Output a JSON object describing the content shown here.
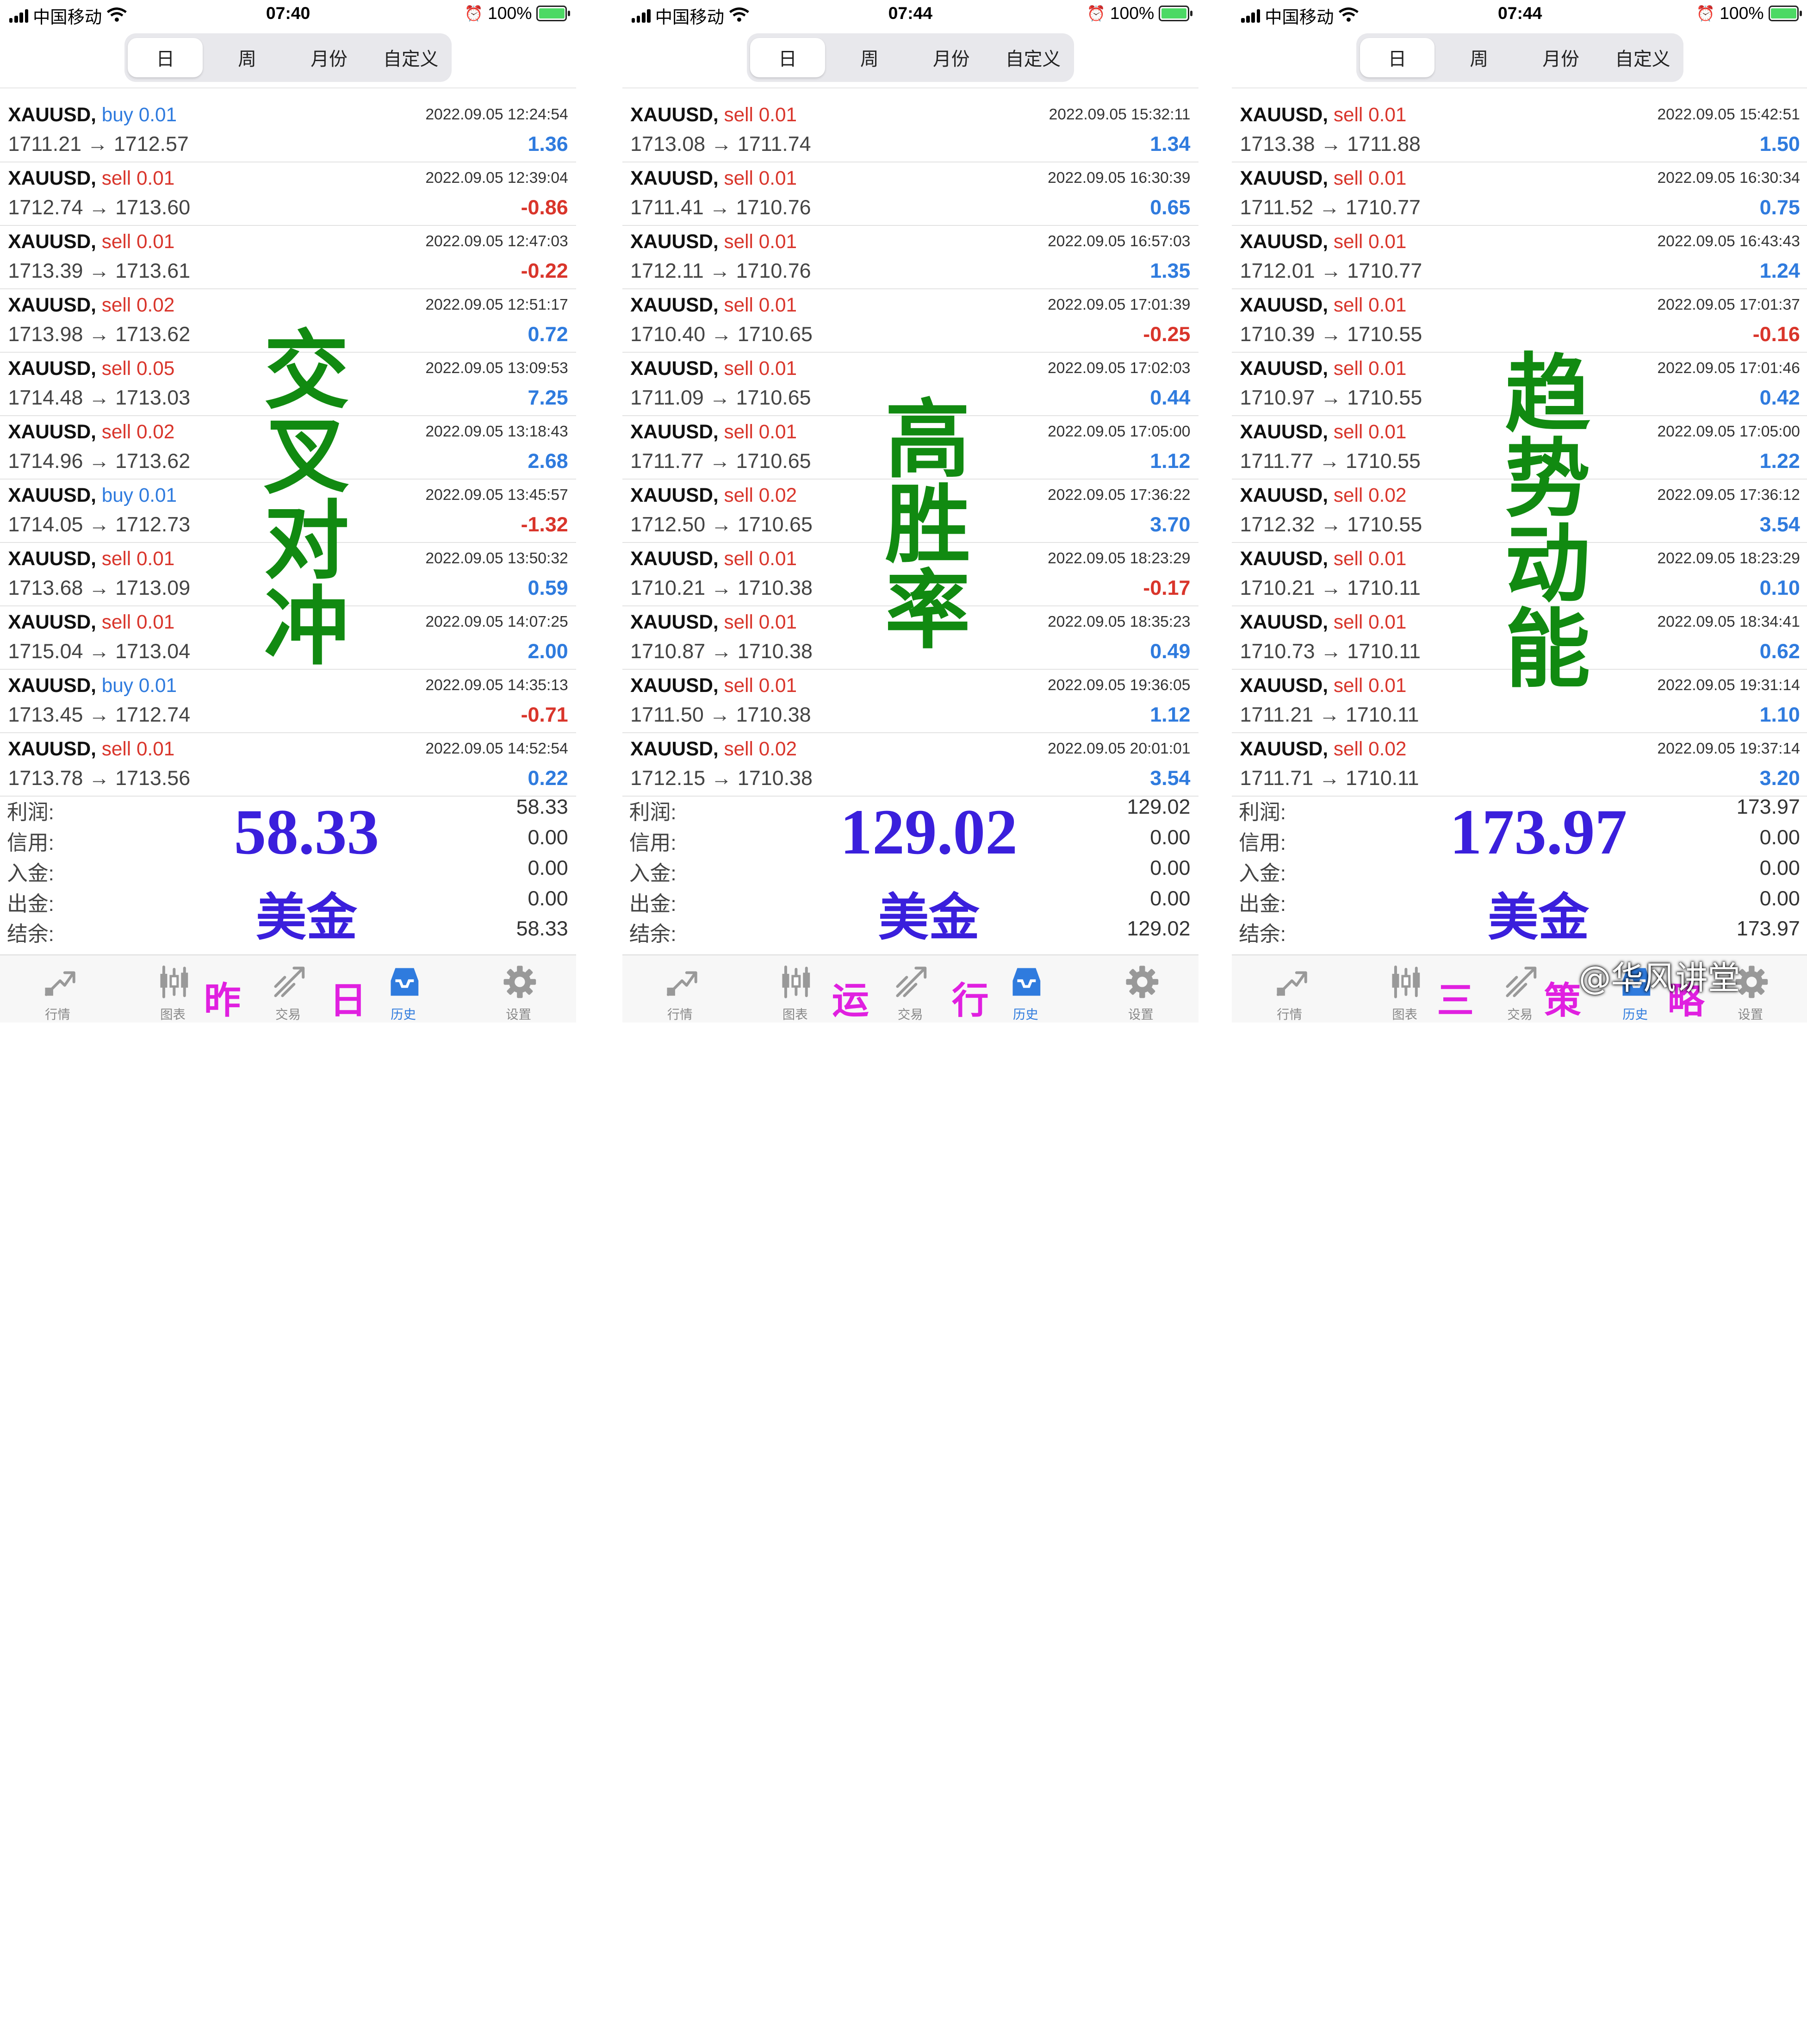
{
  "colors": {
    "accent_blue": "#2f7bde",
    "loss_red": "#d9352b",
    "overlay_green": "#118a11",
    "overlay_violet": "#3a1fdc",
    "caption_magenta": "#e020e0"
  },
  "status": {
    "carrier": "中国移动",
    "battery": "100%"
  },
  "segments": [
    "日",
    "周",
    "月份",
    "自定义"
  ],
  "summary_labels": [
    "利润:",
    "信用:",
    "入金:",
    "出金:",
    "结余:"
  ],
  "tabs": [
    {
      "label": "行情",
      "icon": "chart-arrow-icon"
    },
    {
      "label": "图表",
      "icon": "candlestick-icon"
    },
    {
      "label": "交易",
      "icon": "trade-icon"
    },
    {
      "label": "历史",
      "icon": "history-inbox-icon"
    },
    {
      "label": "设置",
      "icon": "gear-icon"
    }
  ],
  "phones": [
    {
      "time": "07:40",
      "rows": [
        {
          "sym": "XAUUSD,",
          "type": "buy",
          "lot": "0.01",
          "time": "2022.09.05 12:24:54",
          "open": "1711.21",
          "close": "1712.57",
          "profit": "1.36"
        },
        {
          "sym": "XAUUSD,",
          "type": "sell",
          "lot": "0.01",
          "time": "2022.09.05 12:39:04",
          "open": "1712.74",
          "close": "1713.60",
          "profit": "-0.86"
        },
        {
          "sym": "XAUUSD,",
          "type": "sell",
          "lot": "0.01",
          "time": "2022.09.05 12:47:03",
          "open": "1713.39",
          "close": "1713.61",
          "profit": "-0.22"
        },
        {
          "sym": "XAUUSD,",
          "type": "sell",
          "lot": "0.02",
          "time": "2022.09.05 12:51:17",
          "open": "1713.98",
          "close": "1713.62",
          "profit": "0.72"
        },
        {
          "sym": "XAUUSD,",
          "type": "sell",
          "lot": "0.05",
          "time": "2022.09.05 13:09:53",
          "open": "1714.48",
          "close": "1713.03",
          "profit": "7.25"
        },
        {
          "sym": "XAUUSD,",
          "type": "sell",
          "lot": "0.02",
          "time": "2022.09.05 13:18:43",
          "open": "1714.96",
          "close": "1713.62",
          "profit": "2.68"
        },
        {
          "sym": "XAUUSD,",
          "type": "buy",
          "lot": "0.01",
          "time": "2022.09.05 13:45:57",
          "open": "1714.05",
          "close": "1712.73",
          "profit": "-1.32"
        },
        {
          "sym": "XAUUSD,",
          "type": "sell",
          "lot": "0.01",
          "time": "2022.09.05 13:50:32",
          "open": "1713.68",
          "close": "1713.09",
          "profit": "0.59"
        },
        {
          "sym": "XAUUSD,",
          "type": "sell",
          "lot": "0.01",
          "time": "2022.09.05 14:07:25",
          "open": "1715.04",
          "close": "1713.04",
          "profit": "2.00"
        },
        {
          "sym": "XAUUSD,",
          "type": "buy",
          "lot": "0.01",
          "time": "2022.09.05 14:35:13",
          "open": "1713.45",
          "close": "1712.74",
          "profit": "-0.71"
        },
        {
          "sym": "XAUUSD,",
          "type": "sell",
          "lot": "0.01",
          "time": "2022.09.05 14:52:54",
          "open": "1713.78",
          "close": "1713.56",
          "profit": "0.22"
        }
      ],
      "summary": [
        "58.33",
        "0.00",
        "0.00",
        "0.00",
        "58.33"
      ],
      "overlay_title": [
        "交",
        "叉",
        "对",
        "冲"
      ],
      "overlay_amount": "58.33",
      "overlay_unit": "美金",
      "caption": [
        "昨",
        "日"
      ]
    },
    {
      "time": "07:44",
      "rows": [
        {
          "sym": "XAUUSD,",
          "type": "sell",
          "lot": "0.01",
          "time": "2022.09.05 15:32:11",
          "open": "1713.08",
          "close": "1711.74",
          "profit": "1.34"
        },
        {
          "sym": "XAUUSD,",
          "type": "sell",
          "lot": "0.01",
          "time": "2022.09.05 16:30:39",
          "open": "1711.41",
          "close": "1710.76",
          "profit": "0.65"
        },
        {
          "sym": "XAUUSD,",
          "type": "sell",
          "lot": "0.01",
          "time": "2022.09.05 16:57:03",
          "open": "1712.11",
          "close": "1710.76",
          "profit": "1.35"
        },
        {
          "sym": "XAUUSD,",
          "type": "sell",
          "lot": "0.01",
          "time": "2022.09.05 17:01:39",
          "open": "1710.40",
          "close": "1710.65",
          "profit": "-0.25"
        },
        {
          "sym": "XAUUSD,",
          "type": "sell",
          "lot": "0.01",
          "time": "2022.09.05 17:02:03",
          "open": "1711.09",
          "close": "1710.65",
          "profit": "0.44"
        },
        {
          "sym": "XAUUSD,",
          "type": "sell",
          "lot": "0.01",
          "time": "2022.09.05 17:05:00",
          "open": "1711.77",
          "close": "1710.65",
          "profit": "1.12"
        },
        {
          "sym": "XAUUSD,",
          "type": "sell",
          "lot": "0.02",
          "time": "2022.09.05 17:36:22",
          "open": "1712.50",
          "close": "1710.65",
          "profit": "3.70"
        },
        {
          "sym": "XAUUSD,",
          "type": "sell",
          "lot": "0.01",
          "time": "2022.09.05 18:23:29",
          "open": "1710.21",
          "close": "1710.38",
          "profit": "-0.17"
        },
        {
          "sym": "XAUUSD,",
          "type": "sell",
          "lot": "0.01",
          "time": "2022.09.05 18:35:23",
          "open": "1710.87",
          "close": "1710.38",
          "profit": "0.49"
        },
        {
          "sym": "XAUUSD,",
          "type": "sell",
          "lot": "0.01",
          "time": "2022.09.05 19:36:05",
          "open": "1711.50",
          "close": "1710.38",
          "profit": "1.12"
        },
        {
          "sym": "XAUUSD,",
          "type": "sell",
          "lot": "0.02",
          "time": "2022.09.05 20:01:01",
          "open": "1712.15",
          "close": "1710.38",
          "profit": "3.54"
        }
      ],
      "summary": [
        "129.02",
        "0.00",
        "0.00",
        "0.00",
        "129.02"
      ],
      "overlay_title": [
        "高",
        "胜",
        "率"
      ],
      "overlay_amount": "129.02",
      "overlay_unit": "美金",
      "caption": [
        "运",
        "行"
      ]
    },
    {
      "time": "07:44",
      "rows": [
        {
          "sym": "XAUUSD,",
          "type": "sell",
          "lot": "0.01",
          "time": "2022.09.05 15:42:51",
          "open": "1713.38",
          "close": "1711.88",
          "profit": "1.50"
        },
        {
          "sym": "XAUUSD,",
          "type": "sell",
          "lot": "0.01",
          "time": "2022.09.05 16:30:34",
          "open": "1711.52",
          "close": "1710.77",
          "profit": "0.75"
        },
        {
          "sym": "XAUUSD,",
          "type": "sell",
          "lot": "0.01",
          "time": "2022.09.05 16:43:43",
          "open": "1712.01",
          "close": "1710.77",
          "profit": "1.24"
        },
        {
          "sym": "XAUUSD,",
          "type": "sell",
          "lot": "0.01",
          "time": "2022.09.05 17:01:37",
          "open": "1710.39",
          "close": "1710.55",
          "profit": "-0.16"
        },
        {
          "sym": "XAUUSD,",
          "type": "sell",
          "lot": "0.01",
          "time": "2022.09.05 17:01:46",
          "open": "1710.97",
          "close": "1710.55",
          "profit": "0.42"
        },
        {
          "sym": "XAUUSD,",
          "type": "sell",
          "lot": "0.01",
          "time": "2022.09.05 17:05:00",
          "open": "1711.77",
          "close": "1710.55",
          "profit": "1.22"
        },
        {
          "sym": "XAUUSD,",
          "type": "sell",
          "lot": "0.02",
          "time": "2022.09.05 17:36:12",
          "open": "1712.32",
          "close": "1710.55",
          "profit": "3.54"
        },
        {
          "sym": "XAUUSD,",
          "type": "sell",
          "lot": "0.01",
          "time": "2022.09.05 18:23:29",
          "open": "1710.21",
          "close": "1710.11",
          "profit": "0.10"
        },
        {
          "sym": "XAUUSD,",
          "type": "sell",
          "lot": "0.01",
          "time": "2022.09.05 18:34:41",
          "open": "1710.73",
          "close": "1710.11",
          "profit": "0.62"
        },
        {
          "sym": "XAUUSD,",
          "type": "sell",
          "lot": "0.01",
          "time": "2022.09.05 19:31:14",
          "open": "1711.21",
          "close": "1710.11",
          "profit": "1.10"
        },
        {
          "sym": "XAUUSD,",
          "type": "sell",
          "lot": "0.02",
          "time": "2022.09.05 19:37:14",
          "open": "1711.71",
          "close": "1710.11",
          "profit": "3.20"
        }
      ],
      "summary": [
        "173.97",
        "0.00",
        "0.00",
        "0.00",
        "173.97"
      ],
      "overlay_title": [
        "趋",
        "势",
        "动",
        "能"
      ],
      "overlay_amount": "173.97",
      "overlay_unit": "美金",
      "caption": [
        "三",
        "策",
        "略"
      ]
    }
  ],
  "watermark": "@华风讲堂"
}
